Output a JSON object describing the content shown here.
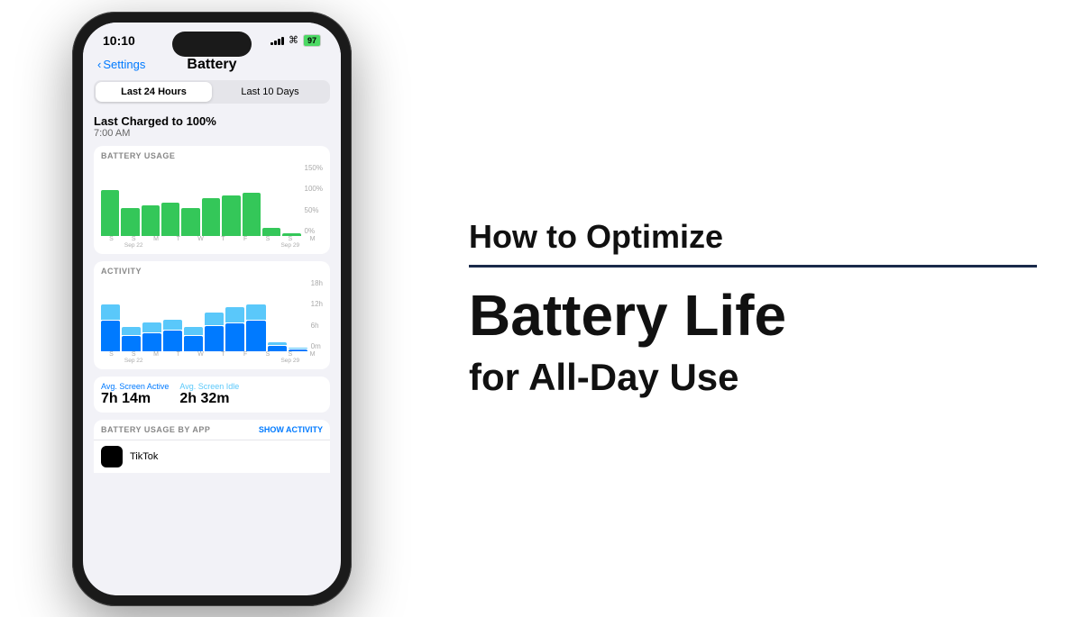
{
  "phone": {
    "status": {
      "time": "10:10",
      "battery_pct": "97"
    },
    "nav": {
      "back_label": "Settings",
      "title": "Battery"
    },
    "segment": {
      "option1": "Last 24 Hours",
      "option2": "Last 10 Days",
      "active": 0
    },
    "last_charged": {
      "title": "Last Charged to 100%",
      "subtitle": "7:00 AM"
    },
    "battery_usage": {
      "label": "BATTERY USAGE",
      "y_labels": [
        "150%",
        "100%",
        "50%",
        "0%"
      ],
      "bars": [
        90,
        55,
        60,
        65,
        55,
        75,
        80,
        85,
        15,
        5
      ],
      "x_labels": [
        "S",
        "S",
        "M",
        "T",
        "W",
        "T",
        "F",
        "S",
        "S",
        "M"
      ],
      "x_sub1": "Sep 22",
      "x_sub2": "Sep 29"
    },
    "activity": {
      "label": "ACTIVITY",
      "y_labels": [
        "18h",
        "12h",
        "6h",
        "0m"
      ],
      "bars_dark": [
        60,
        30,
        35,
        40,
        30,
        50,
        55,
        60,
        10,
        3
      ],
      "bars_light": [
        30,
        15,
        20,
        20,
        15,
        25,
        30,
        30,
        5,
        2
      ],
      "x_labels": [
        "S",
        "S",
        "M",
        "T",
        "W",
        "T",
        "F",
        "S",
        "S",
        "M"
      ],
      "x_sub1": "Sep 22",
      "x_sub2": "Sep 29"
    },
    "stats": {
      "screen_active_label": "Avg. Screen Active",
      "screen_active_value": "7h 14m",
      "screen_idle_label": "Avg. Screen Idle",
      "screen_idle_value": "2h 32m"
    },
    "by_app": {
      "title": "BATTERY USAGE BY APP",
      "show_activity": "SHOW ACTIVITY",
      "apps": [
        {
          "name": "TikTok",
          "color": "#000000"
        }
      ]
    }
  },
  "article": {
    "headline_sub": "How to Optimize",
    "headline_main": "Battery Life",
    "headline_sub2": "for All-Day Use"
  }
}
